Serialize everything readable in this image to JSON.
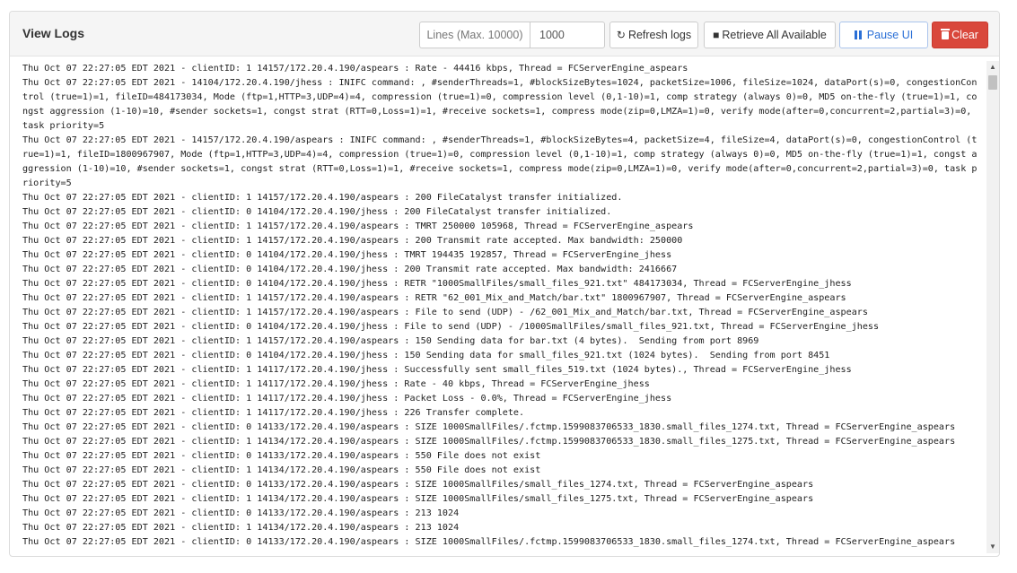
{
  "header": {
    "title": "View Logs",
    "lines_label": "Lines (Max. 10000)",
    "lines_value": "1000",
    "refresh_label": "Refresh logs",
    "retrieve_label": "Retrieve All Available",
    "pause_label": "Pause UI",
    "clear_label": "Clear"
  },
  "icons": {
    "refresh": "refresh-icon",
    "retrieve": "book-icon",
    "pause": "pause-icon",
    "clear": "trash-icon"
  },
  "colors": {
    "clear_button": "#d9473b",
    "pause_text": "#2a6fd6"
  },
  "logs": [
    "Thu Oct 07 22:27:05 EDT 2021 - clientID: 1 14157/172.20.4.190/aspears : Rate - 44416 kbps, Thread = FCServerEngine_aspears",
    "Thu Oct 07 22:27:05 EDT 2021 - 14104/172.20.4.190/jhess : INIFC command: , #senderThreads=1, #blockSizeBytes=1024, packetSize=1006, fileSize=1024, dataPort(s)=0, congestionControl (true=1)=1, fileID=484173034, Mode (ftp=1,HTTP=3,UDP=4)=4, compression (true=1)=0, compression level (0,1-10)=1, comp strategy (always 0)=0, MD5 on-the-fly (true=1)=1, congst aggression (1-10)=10, #sender sockets=1, congst strat (RTT=0,Loss=1)=1, #receive sockets=1, compress mode(zip=0,LMZA=1)=0, verify mode(after=0,concurrent=2,partial=3)=0, task priority=5",
    "Thu Oct 07 22:27:05 EDT 2021 - 14157/172.20.4.190/aspears : INIFC command: , #senderThreads=1, #blockSizeBytes=4, packetSize=4, fileSize=4, dataPort(s)=0, congestionControl (true=1)=1, fileID=1800967907, Mode (ftp=1,HTTP=3,UDP=4)=4, compression (true=1)=0, compression level (0,1-10)=1, comp strategy (always 0)=0, MD5 on-the-fly (true=1)=1, congst aggression (1-10)=10, #sender sockets=1, congst strat (RTT=0,Loss=1)=1, #receive sockets=1, compress mode(zip=0,LMZA=1)=0, verify mode(after=0,concurrent=2,partial=3)=0, task priority=5",
    "Thu Oct 07 22:27:05 EDT 2021 - clientID: 1 14157/172.20.4.190/aspears : 200 FileCatalyst transfer initialized.",
    "Thu Oct 07 22:27:05 EDT 2021 - clientID: 0 14104/172.20.4.190/jhess : 200 FileCatalyst transfer initialized.",
    "Thu Oct 07 22:27:05 EDT 2021 - clientID: 1 14157/172.20.4.190/aspears : TMRT 250000 105968, Thread = FCServerEngine_aspears",
    "Thu Oct 07 22:27:05 EDT 2021 - clientID: 1 14157/172.20.4.190/aspears : 200 Transmit rate accepted. Max bandwidth: 250000",
    "Thu Oct 07 22:27:05 EDT 2021 - clientID: 0 14104/172.20.4.190/jhess : TMRT 194435 192857, Thread = FCServerEngine_jhess",
    "Thu Oct 07 22:27:05 EDT 2021 - clientID: 0 14104/172.20.4.190/jhess : 200 Transmit rate accepted. Max bandwidth: 2416667",
    "Thu Oct 07 22:27:05 EDT 2021 - clientID: 0 14104/172.20.4.190/jhess : RETR \"1000SmallFiles/small_files_921.txt\" 484173034, Thread = FCServerEngine_jhess",
    "Thu Oct 07 22:27:05 EDT 2021 - clientID: 1 14157/172.20.4.190/aspears : RETR \"62_001_Mix_and_Match/bar.txt\" 1800967907, Thread = FCServerEngine_aspears",
    "Thu Oct 07 22:27:05 EDT 2021 - clientID: 1 14157/172.20.4.190/aspears : File to send (UDP) - /62_001_Mix_and_Match/bar.txt, Thread = FCServerEngine_aspears",
    "Thu Oct 07 22:27:05 EDT 2021 - clientID: 0 14104/172.20.4.190/jhess : File to send (UDP) - /1000SmallFiles/small_files_921.txt, Thread = FCServerEngine_jhess",
    "Thu Oct 07 22:27:05 EDT 2021 - clientID: 1 14157/172.20.4.190/aspears : 150 Sending data for bar.txt (4 bytes).  Sending from port 8969",
    "Thu Oct 07 22:27:05 EDT 2021 - clientID: 0 14104/172.20.4.190/jhess : 150 Sending data for small_files_921.txt (1024 bytes).  Sending from port 8451",
    "Thu Oct 07 22:27:05 EDT 2021 - clientID: 1 14117/172.20.4.190/jhess : Successfully sent small_files_519.txt (1024 bytes)., Thread = FCServerEngine_jhess",
    "Thu Oct 07 22:27:05 EDT 2021 - clientID: 1 14117/172.20.4.190/jhess : Rate - 40 kbps, Thread = FCServerEngine_jhess",
    "Thu Oct 07 22:27:05 EDT 2021 - clientID: 1 14117/172.20.4.190/jhess : Packet Loss - 0.0%, Thread = FCServerEngine_jhess",
    "Thu Oct 07 22:27:05 EDT 2021 - clientID: 1 14117/172.20.4.190/jhess : 226 Transfer complete.",
    "Thu Oct 07 22:27:05 EDT 2021 - clientID: 0 14133/172.20.4.190/aspears : SIZE 1000SmallFiles/.fctmp.1599083706533_1830.small_files_1274.txt, Thread = FCServerEngine_aspears",
    "Thu Oct 07 22:27:05 EDT 2021 - clientID: 1 14134/172.20.4.190/aspears : SIZE 1000SmallFiles/.fctmp.1599083706533_1830.small_files_1275.txt, Thread = FCServerEngine_aspears",
    "Thu Oct 07 22:27:05 EDT 2021 - clientID: 0 14133/172.20.4.190/aspears : 550 File does not exist",
    "Thu Oct 07 22:27:05 EDT 2021 - clientID: 1 14134/172.20.4.190/aspears : 550 File does not exist",
    "Thu Oct 07 22:27:05 EDT 2021 - clientID: 0 14133/172.20.4.190/aspears : SIZE 1000SmallFiles/small_files_1274.txt, Thread = FCServerEngine_aspears",
    "Thu Oct 07 22:27:05 EDT 2021 - clientID: 1 14134/172.20.4.190/aspears : SIZE 1000SmallFiles/small_files_1275.txt, Thread = FCServerEngine_aspears",
    "Thu Oct 07 22:27:05 EDT 2021 - clientID: 0 14133/172.20.4.190/aspears : 213 1024",
    "Thu Oct 07 22:27:05 EDT 2021 - clientID: 1 14134/172.20.4.190/aspears : 213 1024",
    "Thu Oct 07 22:27:05 EDT 2021 - clientID: 0 14133/172.20.4.190/aspears : SIZE 1000SmallFiles/.fctmp.1599083706533_1830.small_files_1274.txt, Thread = FCServerEngine_aspears"
  ]
}
